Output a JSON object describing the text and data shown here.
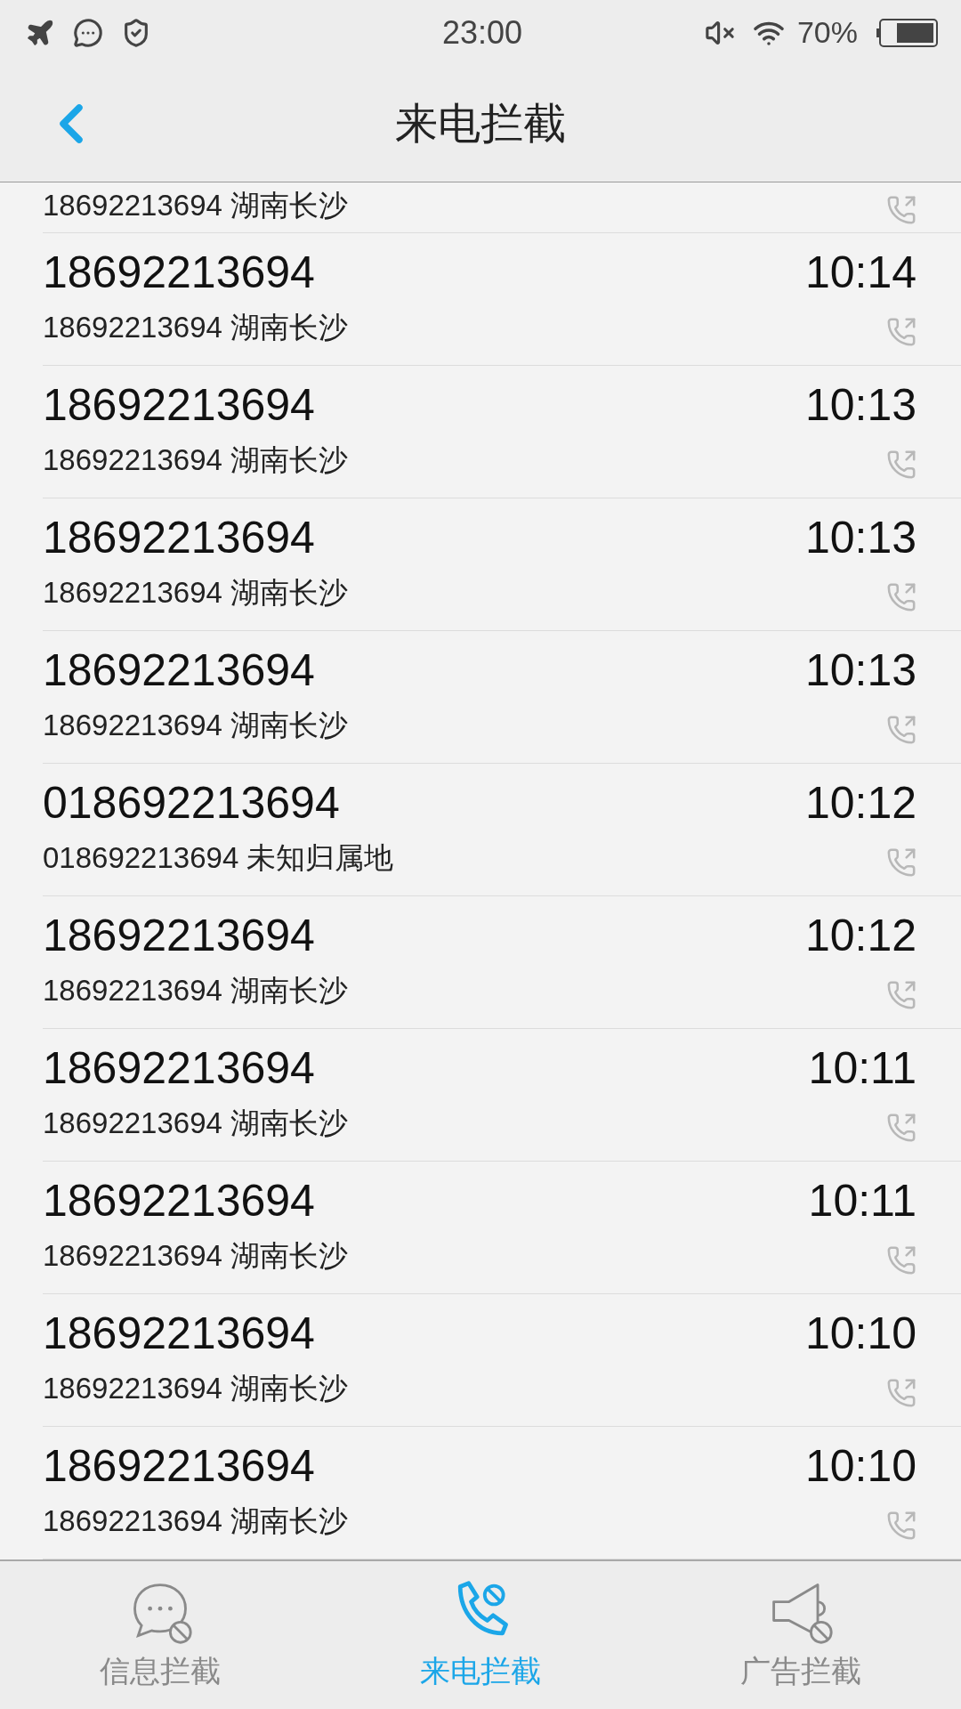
{
  "status_bar": {
    "time": "23:00",
    "battery": "70%"
  },
  "header": {
    "title": "来电拦截"
  },
  "calls": [
    {
      "detail": "18692213694 湖南长沙"
    },
    {
      "number": "18692213694",
      "time": "10:14",
      "detail": "18692213694 湖南长沙"
    },
    {
      "number": "18692213694",
      "time": "10:13",
      "detail": "18692213694 湖南长沙"
    },
    {
      "number": "18692213694",
      "time": "10:13",
      "detail": "18692213694 湖南长沙"
    },
    {
      "number": "18692213694",
      "time": "10:13",
      "detail": "18692213694 湖南长沙"
    },
    {
      "number": "018692213694",
      "time": "10:12",
      "detail": "018692213694 未知归属地"
    },
    {
      "number": "18692213694",
      "time": "10:12",
      "detail": "18692213694 湖南长沙"
    },
    {
      "number": "18692213694",
      "time": "10:11",
      "detail": "18692213694 湖南长沙"
    },
    {
      "number": "18692213694",
      "time": "10:11",
      "detail": "18692213694 湖南长沙"
    },
    {
      "number": "18692213694",
      "time": "10:10",
      "detail": "18692213694 湖南长沙"
    },
    {
      "number": "18692213694",
      "time": "10:10",
      "detail": "18692213694 湖南长沙"
    }
  ],
  "tabs": [
    {
      "kind": "messages",
      "label": "信息拦截",
      "selected": false
    },
    {
      "kind": "calls",
      "label": "来电拦截",
      "selected": true
    },
    {
      "kind": "ads",
      "label": "广告拦截",
      "selected": false
    }
  ]
}
